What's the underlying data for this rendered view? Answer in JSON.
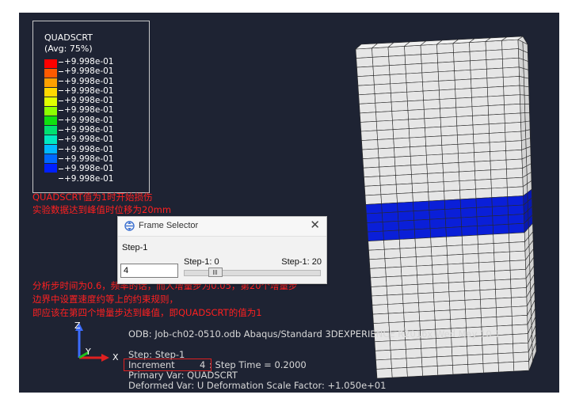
{
  "legend": {
    "title": "QUADSCRT",
    "subtitle": "(Avg: 75%)",
    "values": [
      "+9.998e-01",
      "+9.998e-01",
      "+9.998e-01",
      "+9.998e-01",
      "+9.998e-01",
      "+9.998e-01",
      "+9.998e-01",
      "+9.998e-01",
      "+9.998e-01",
      "+9.998e-01",
      "+9.998e-01",
      "+9.998e-01",
      "+9.998e-01"
    ],
    "colors": [
      "#ff0000",
      "#ff5a00",
      "#ffa000",
      "#ffd800",
      "#e0ff00",
      "#8cff00",
      "#10e010",
      "#00e070",
      "#00e8c0",
      "#00b8ff",
      "#0068ff",
      "#0020ff"
    ]
  },
  "annotations": {
    "top": [
      "QUADSCRT值为1时开始损伤",
      "实验数据达到峰值时位移为20mm"
    ],
    "bottom": [
      "分析步时间为0.6，频率的话，而人增量步为0.05，第20个增量步",
      "边界中设置速度约等上的约束规则，",
      "即应该在第四个增量步达到峰值，即QUADSCRT的值为1"
    ]
  },
  "dialog": {
    "title": "Frame Selector",
    "close": "✕",
    "step_label": "Step-1",
    "frame_value": "4",
    "range_start": "Step-1: 0",
    "range_end": "Step-1: 20",
    "frame_max": 20
  },
  "info": {
    "odb_line": "ODB: Job-ch02-0510.odb    Abaqus/Standard 3DEXPERIENCE R2016x    Wed May 10 1",
    "step_line": "Step: Step-1",
    "increment_label": "Increment",
    "increment_value": "4",
    "step_time": ": Step Time =    0.2000",
    "primary_var": "Primary Var: QUADSCRT",
    "deformed_var": "Deformed Var: U   Deformation Scale Factor: +1.050e+01"
  },
  "triad": {
    "x": "X",
    "y": "Y",
    "z": "Z"
  },
  "colors": {
    "background": "#1e2333",
    "damaged": "#0a1fd8",
    "mesh": "#e6e6e6",
    "annotation": "#ff2020"
  }
}
